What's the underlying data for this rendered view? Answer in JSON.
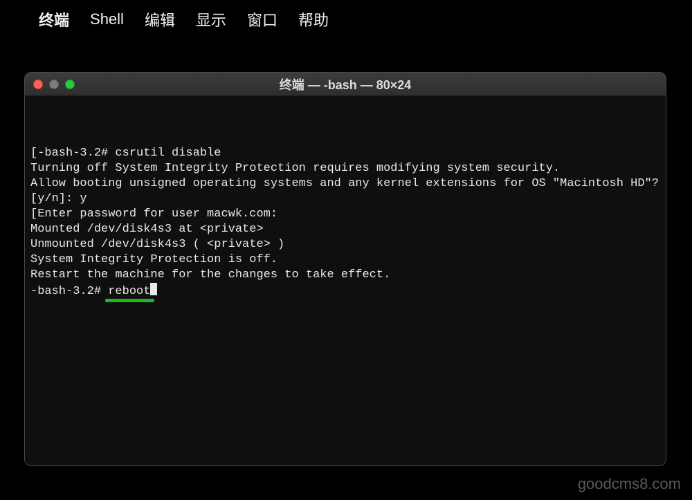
{
  "menubar": {
    "app_name": "终端",
    "items": [
      {
        "label": "Shell"
      },
      {
        "label": "编辑"
      },
      {
        "label": "显示"
      },
      {
        "label": "窗口"
      },
      {
        "label": "帮助"
      }
    ]
  },
  "window": {
    "title": "终端 — -bash — 80×24",
    "terminal_lines": [
      "[-bash-3.2# csrutil disable",
      "Turning off System Integrity Protection requires modifying system security.",
      "Allow booting unsigned operating systems and any kernel extensions for OS \"Macintosh HD\"? [y/n]: y",
      "",
      "[Enter password for user macwk.com:",
      "Mounted /dev/disk4s3 at <private>",
      "Unmounted /dev/disk4s3 ( <private> )",
      "System Integrity Protection is off.",
      "Restart the machine for the changes to take effect."
    ],
    "prompt": "-bash-3.2# ",
    "typed_command": "reboot",
    "annotations": {
      "underline_word": "reboot",
      "underline_color": "#1db91d"
    }
  },
  "watermark": "goodcms8.com"
}
